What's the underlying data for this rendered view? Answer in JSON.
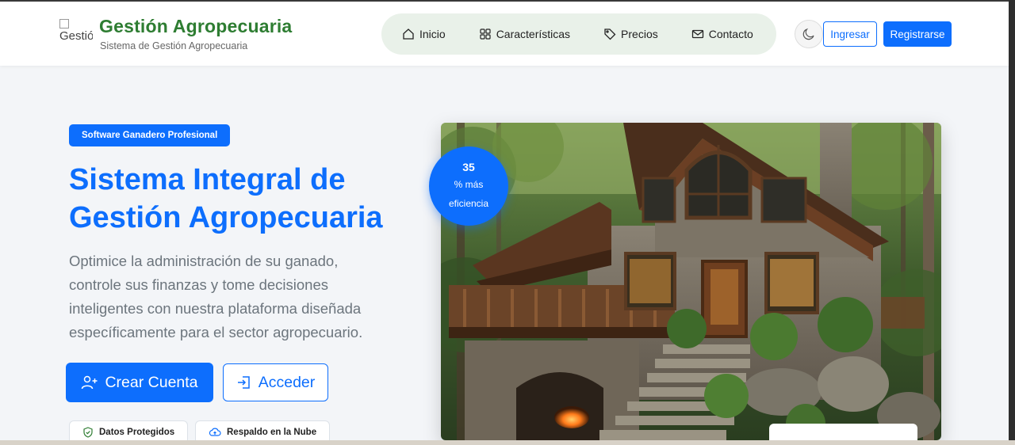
{
  "brand": {
    "image_alt": "Gestión",
    "title": "Gestión Agropecuaria",
    "subtitle": "Sistema de Gestión Agropecuaria"
  },
  "nav": {
    "items": [
      {
        "label": "Inicio",
        "icon": "home-icon"
      },
      {
        "label": "Características",
        "icon": "grid-icon"
      },
      {
        "label": "Precios",
        "icon": "tag-icon"
      },
      {
        "label": "Contacto",
        "icon": "envelope-icon"
      }
    ]
  },
  "header_actions": {
    "theme_icon": "moon-icon",
    "login_label": "Ingresar",
    "register_label": "Registrarse"
  },
  "hero": {
    "badge": "Software Ganadero Profesional",
    "title": "Sistema Integral de Gestión Agropecuaria",
    "description": "Optimice la administración de su ganado, controle sus finanzas y tome decisiones inteligentes con nuestra plataforma diseñada específicamente para el sector agropecuario.",
    "create_label": "Crear Cuenta",
    "access_label": "Acceder",
    "chips": [
      {
        "label": "Datos Protegidos",
        "icon": "shield-check-icon"
      },
      {
        "label": "Respaldo en la Nube",
        "icon": "cloud-icon"
      }
    ]
  },
  "stat": {
    "value": "35",
    "label_line1": "% más",
    "label_line2": "eficiencia"
  },
  "colors": {
    "primary": "#0d6efd",
    "brand_green": "#2e7d32",
    "nav_bg": "#e9f1e9"
  }
}
